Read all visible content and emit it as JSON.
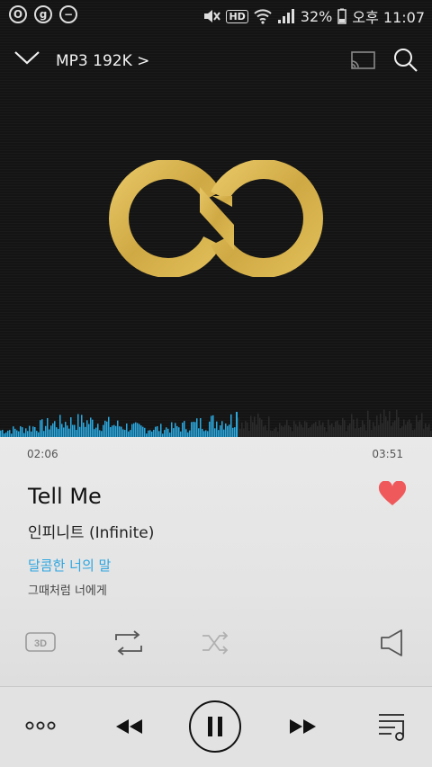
{
  "status_bar": {
    "left_icons": [
      "opera-icon",
      "g-icon",
      "minus-circle-icon"
    ],
    "hd_label": "HD",
    "battery": "32%",
    "time": "오후 11:07"
  },
  "toolbar": {
    "quality_label": "MP3 192K",
    "quality_chevron": ">"
  },
  "playback": {
    "current_time": "02:06",
    "total_time": "03:51",
    "progress": 0.545
  },
  "track": {
    "title": "Tell Me",
    "artist": "인피니트 (Infinite)",
    "liked": true
  },
  "lyrics": {
    "current_line": "달콤한 너의 말",
    "next_line": "그때처럼 너에게"
  },
  "controls": {
    "effect_label": "3D"
  },
  "colors": {
    "accent": "#2fa6e0",
    "heart": "#f0595b",
    "logo": "#d7b452",
    "wave_played": "#2aa9e0"
  }
}
